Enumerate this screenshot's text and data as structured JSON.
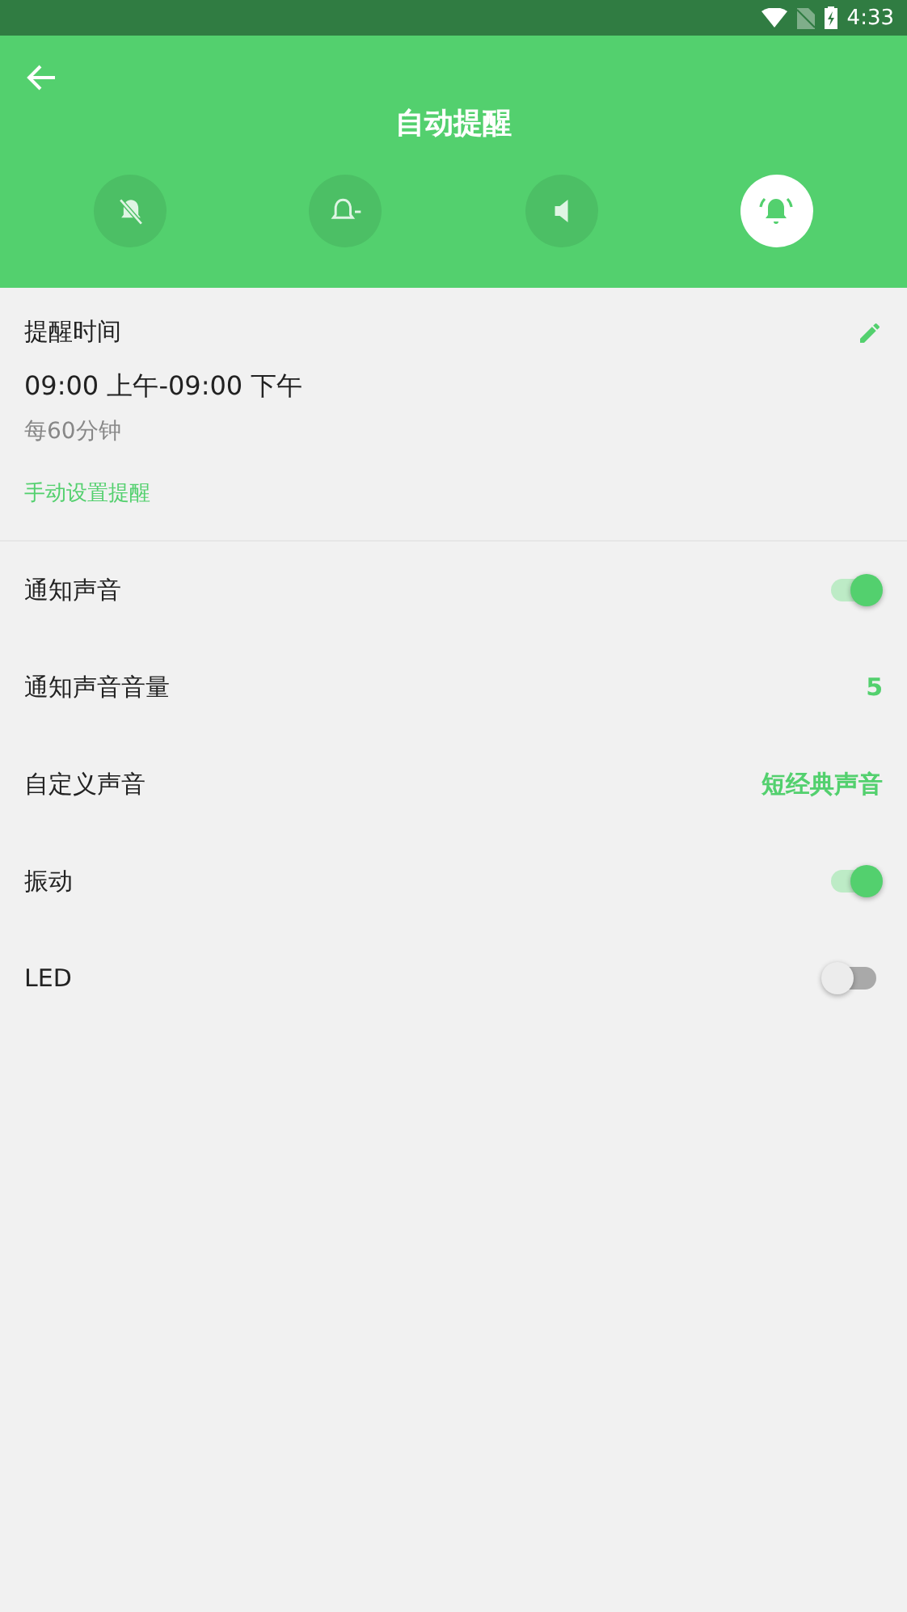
{
  "status_bar": {
    "time": "4:33"
  },
  "header": {
    "title": "自动提醒"
  },
  "modes": [
    {
      "kind": "mute",
      "selected": false
    },
    {
      "kind": "less",
      "selected": false
    },
    {
      "kind": "sound",
      "selected": false
    },
    {
      "kind": "ring",
      "selected": true
    }
  ],
  "reminder": {
    "label": "提醒时间",
    "time_range": "09:00 上午-09:00 下午",
    "interval": "每60分钟",
    "manual_link": "手动设置提醒"
  },
  "settings": [
    {
      "kind": "toggle",
      "label": "通知声音",
      "on": true
    },
    {
      "kind": "value",
      "label": "通知声音音量",
      "value": "5"
    },
    {
      "kind": "value",
      "label": "自定义声音",
      "value": "短经典声音"
    },
    {
      "kind": "toggle",
      "label": "振动",
      "on": true
    },
    {
      "kind": "toggle",
      "label": "LED",
      "on": false
    }
  ]
}
